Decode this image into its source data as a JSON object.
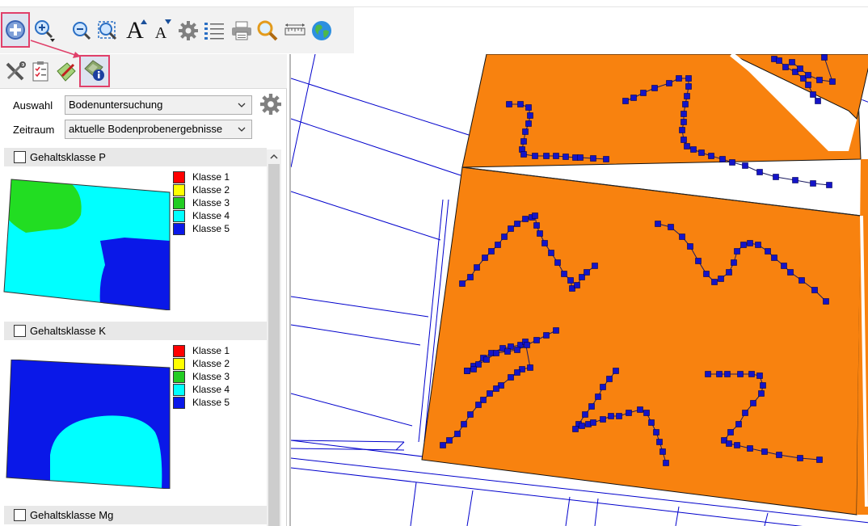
{
  "toolbar": {
    "items": [
      {
        "name": "pan-tool-icon",
        "active": true
      },
      {
        "name": "zoom-in-icon"
      },
      {
        "name": "zoom-out-icon"
      },
      {
        "name": "zoom-extent-icon"
      },
      {
        "name": "font-larger-icon",
        "glyph": "A"
      },
      {
        "name": "font-smaller-icon",
        "glyph": "A"
      },
      {
        "name": "settings-gear-icon"
      },
      {
        "name": "layer-list-icon"
      },
      {
        "name": "print-icon"
      },
      {
        "name": "search-icon"
      },
      {
        "name": "measure-ruler-icon"
      },
      {
        "name": "globe-icon"
      }
    ]
  },
  "left_tools": {
    "items": [
      {
        "name": "tools-icon"
      },
      {
        "name": "checklist-icon"
      },
      {
        "name": "field-edit-icon"
      },
      {
        "name": "map-info-icon",
        "active": true
      }
    ]
  },
  "form": {
    "auswahl_label": "Auswahl",
    "auswahl_value": "Bodenuntersuchung",
    "zeitraum_label": "Zeitraum",
    "zeitraum_value": "aktuelle Bodenprobenergebnisse"
  },
  "groups": [
    {
      "title": "Gehaltsklasse P"
    },
    {
      "title": "Gehaltsklasse K"
    },
    {
      "title": "Gehaltsklasse Mg"
    }
  ],
  "legend": [
    {
      "label": "Klasse 1",
      "color": "#ff0000"
    },
    {
      "label": "Klasse 2",
      "color": "#ffff00"
    },
    {
      "label": "Klasse 3",
      "color": "#22cc22"
    },
    {
      "label": "Klasse 4",
      "color": "#00ffff"
    },
    {
      "label": "Klasse 5",
      "color": "#0a18e8"
    }
  ],
  "colors": {
    "field": "#f8820f",
    "sample_point": "#1414c8",
    "parcel_line": "#0000cc",
    "highlight": "#e0406a"
  }
}
